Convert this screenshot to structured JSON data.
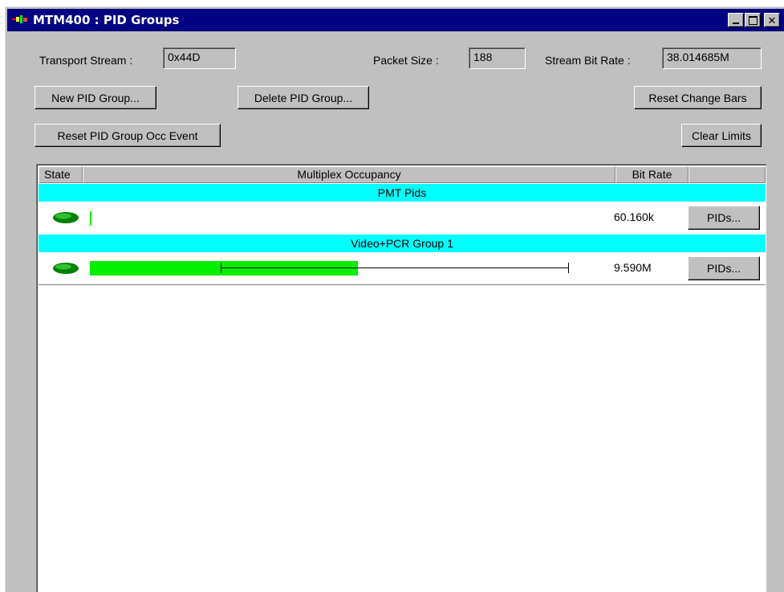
{
  "window": {
    "title": "MTM400 : PID Groups",
    "controls": {
      "minimize_icon": "minimize-icon",
      "maximize_icon": "maximize-icon",
      "close_icon": "close-icon"
    }
  },
  "fields": {
    "transport_stream": {
      "label": "Transport Stream :",
      "value": "0x44D"
    },
    "packet_size": {
      "label": "Packet Size :",
      "value": "188"
    },
    "stream_bit_rate": {
      "label": "Stream Bit Rate :",
      "value": "38.014685M"
    }
  },
  "buttons": {
    "new_pid_group": "New PID Group...",
    "delete_pid_group": "Delete PID Group...",
    "reset_change_bars": "Reset Change Bars",
    "reset_pid_group_occ_event": "Reset PID Group Occ Event",
    "clear_limits": "Clear Limits"
  },
  "table": {
    "columns": [
      "State",
      "Multiplex Occupancy",
      "Bit Rate",
      ""
    ],
    "groups": [
      {
        "name": "PMT Pids",
        "state_color": "#00a000",
        "occupancy_fraction": 0.003,
        "bit_rate": "60.160k",
        "pids_button": "PIDs..."
      },
      {
        "name": "Video+PCR Group 1",
        "state_color": "#00a000",
        "occupancy_fraction": 0.56,
        "limit_min_fraction": 0.273,
        "limit_max_fraction": 1.0,
        "bit_rate": "9.590M",
        "pids_button": "PIDs..."
      }
    ]
  },
  "colors": {
    "title_bar": "#000080",
    "group_band": "#00ffff",
    "occupancy_bar": "#00f000"
  }
}
